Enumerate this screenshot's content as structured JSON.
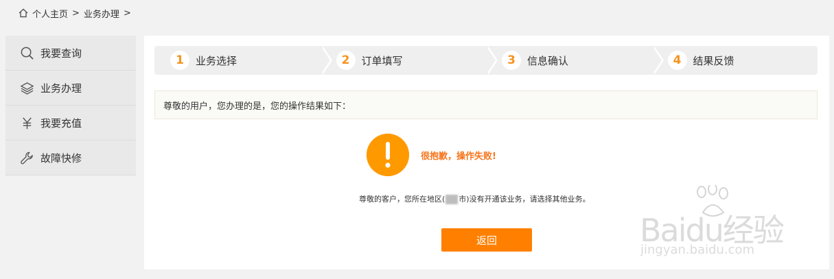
{
  "breadcrumb": {
    "home": "个人主页",
    "current": "业务办理",
    "separator": ">"
  },
  "sidebar": {
    "items": [
      {
        "label": "我要查询",
        "icon": "search-icon"
      },
      {
        "label": "业务办理",
        "icon": "layers-icon"
      },
      {
        "label": "我要充值",
        "icon": "yuan-icon"
      },
      {
        "label": "故障快修",
        "icon": "wrench-icon"
      }
    ]
  },
  "steps": [
    {
      "num": "1",
      "label": "业务选择"
    },
    {
      "num": "2",
      "label": "订单填写"
    },
    {
      "num": "3",
      "label": "信息确认"
    },
    {
      "num": "4",
      "label": "结果反馈"
    }
  ],
  "info": {
    "text": "尊敬的用户，您办理的是，您的操作结果如下："
  },
  "result": {
    "icon": "warning-icon",
    "title": "很抱歉，操作失败!",
    "message_before": "尊敬的客户，您所在地区(",
    "message_after": "市)没有开通该业务，请选择其他业务。"
  },
  "actions": {
    "back_label": "返回"
  },
  "watermark": {
    "main": "Baidu经验",
    "sub": "jingyan.baidu.com"
  },
  "colors": {
    "accent": "#ff8000",
    "warning": "#ff9900",
    "step_number": "#f7931e",
    "page_bg": "#f2f2f2"
  }
}
